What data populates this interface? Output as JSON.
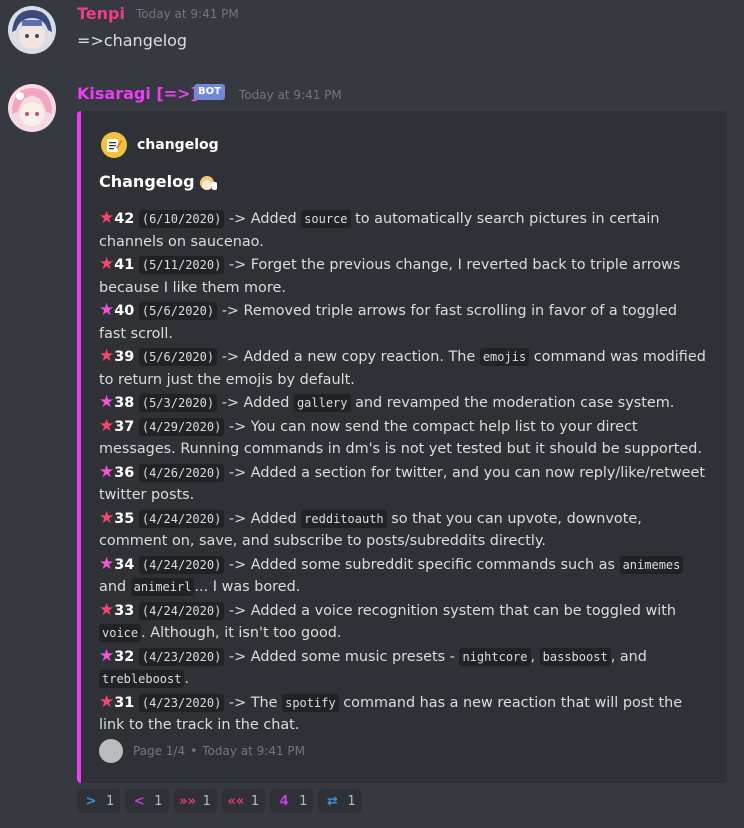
{
  "messages": [
    {
      "username": "Tenpi",
      "timestamp": "Today at 9:41 PM",
      "text": "=>changelog",
      "name_color": "#ee3d8a"
    },
    {
      "username": "Kisaragi [=>]",
      "bot_tag": "BOT",
      "timestamp": "Today at 9:41 PM",
      "name_color": "#ee3df6"
    }
  ],
  "embed": {
    "author": "changelog",
    "title": "Changelog",
    "entries": [
      {
        "num": "42",
        "date": "(6/10/2020)",
        "parts": [
          "-> Added ",
          {
            "code": "source"
          },
          " to automatically search pictures in certain channels on saucenao."
        ]
      },
      {
        "num": "41",
        "date": "(5/11/2020)",
        "parts": [
          "-> Forget the previous change, I reverted back to triple arrows because I like them more."
        ]
      },
      {
        "num": "40",
        "date": "(5/6/2020)",
        "parts": [
          "-> Removed triple arrows for fast scrolling in favor of a toggled fast scroll."
        ]
      },
      {
        "num": "39",
        "date": "(5/6/2020)",
        "parts": [
          "-> Added a new copy reaction. The ",
          {
            "code": "emojis"
          },
          " command was modified to return just the emojis by default."
        ]
      },
      {
        "num": "38",
        "date": "(5/3/2020)",
        "parts": [
          "-> Added ",
          {
            "code": "gallery"
          },
          " and revamped the moderation case system."
        ]
      },
      {
        "num": "37",
        "date": "(4/29/2020)",
        "parts": [
          "-> You can now send the compact help list to your direct messages. Running commands in dm's is not yet tested but it should be supported."
        ]
      },
      {
        "num": "36",
        "date": "(4/26/2020)",
        "parts": [
          "-> Added a section for twitter, and you can now reply/like/retweet twitter posts."
        ]
      },
      {
        "num": "35",
        "date": "(4/24/2020)",
        "parts": [
          "-> Added ",
          {
            "code": "redditoauth"
          },
          " so that you can upvote, downvote, comment on, save, and subscribe to posts/subreddits directly."
        ]
      },
      {
        "num": "34",
        "date": "(4/24/2020)",
        "parts": [
          "-> Added some subreddit specific commands such as ",
          {
            "code": "animemes"
          },
          " and ",
          {
            "code": "animeirl"
          },
          "... I was bored."
        ]
      },
      {
        "num": "33",
        "date": "(4/24/2020)",
        "parts": [
          "-> Added a voice recognition system that can be toggled with ",
          {
            "code": "voice"
          },
          ". Although, it isn't too good."
        ]
      },
      {
        "num": "32",
        "date": "(4/23/2020)",
        "parts": [
          "-> Added some music presets - ",
          {
            "code": "nightcore"
          },
          ", ",
          {
            "code": "bassboost"
          },
          ", and ",
          {
            "code": "trebleboost"
          },
          "."
        ]
      },
      {
        "num": "31",
        "date": "(4/23/2020)",
        "parts": [
          "-> The ",
          {
            "code": "spotify"
          },
          " command has a new reaction that will post the link to the track in the chat."
        ]
      }
    ],
    "footer": {
      "page": "Page 1/4",
      "separator": "•",
      "timestamp": "Today at 9:41 PM"
    },
    "accent_color": "#ee3df6"
  },
  "reactions": [
    {
      "icon": "right-arrow-icon",
      "glyph": ">",
      "color": "#3b8edb",
      "count": "1"
    },
    {
      "icon": "left-arrow-icon",
      "glyph": "<",
      "color": "#c43be0",
      "count": "1"
    },
    {
      "icon": "fast-forward-icon",
      "glyph": "»»",
      "color": "#e0406e",
      "count": "1"
    },
    {
      "icon": "fast-back-icon",
      "glyph": "««",
      "color": "#e0406e",
      "count": "1"
    },
    {
      "icon": "number-4-icon",
      "glyph": "4",
      "color": "#c43be0",
      "count": "1"
    },
    {
      "icon": "copy-swap-icon",
      "glyph": "⇄",
      "color": "#3b8edb",
      "count": "1"
    }
  ]
}
